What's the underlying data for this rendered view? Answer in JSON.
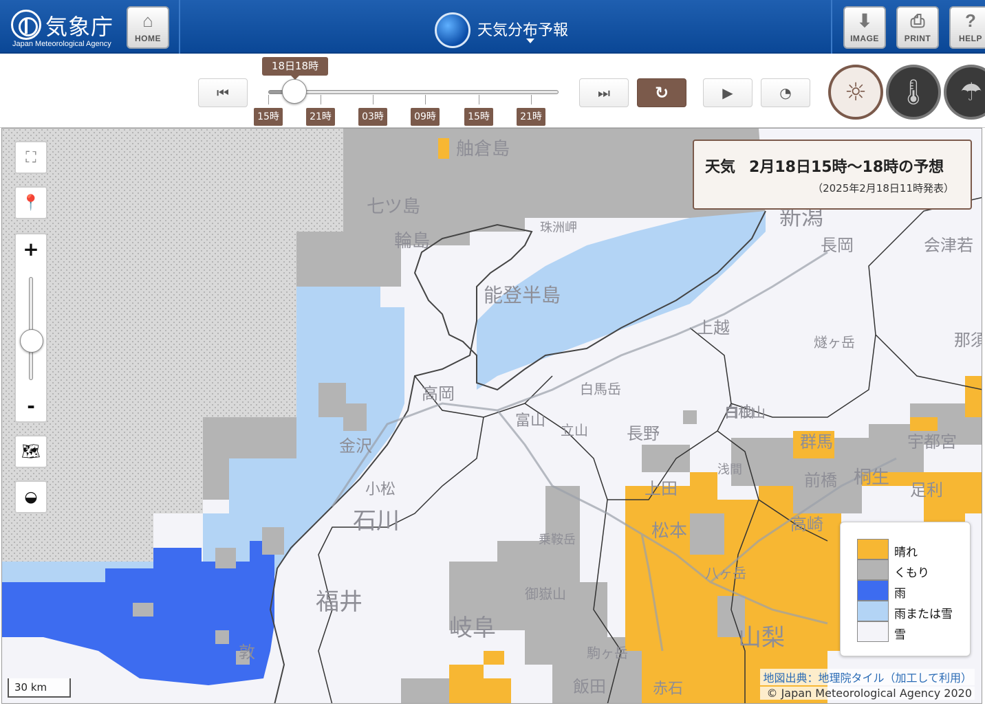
{
  "header": {
    "logo_ja": "気象庁",
    "logo_en": "Japan Meteorological Agency",
    "home_label": "HOME",
    "title": "天気分布予報",
    "image_label": "IMAGE",
    "print_label": "PRINT",
    "help_label": "HELP"
  },
  "timeline": {
    "current_label": "18日18時",
    "ticks": [
      "15時",
      "21時",
      "03時",
      "09時",
      "15時",
      "21時"
    ],
    "position_fraction": 0.09
  },
  "map": {
    "info_title_prefix": "天気",
    "info_title": "2月18日15時～18時の予想",
    "info_sub": "（2025年2月18日11時発表）",
    "scale_label": "30 km",
    "credit_source": "地図出典：地理院タイル（加工して利用）",
    "credit_copy": "© Japan Meteorological Agency 2020",
    "zoom_in": "+",
    "zoom_out": "-",
    "zoom_fraction": 0.45,
    "places": [
      "舳倉島",
      "七ツ島",
      "輪島",
      "能登半島",
      "新潟",
      "長岡",
      "会津若",
      "上越",
      "高岡",
      "富山",
      "立山",
      "長野",
      "白馬岳",
      "金沢",
      "小松",
      "石川",
      "福井",
      "敦",
      "岐阜",
      "飯田",
      "松本",
      "上田",
      "前橋",
      "桐生",
      "高崎",
      "宇都宮",
      "足利",
      "山梨",
      "赤石",
      "駒ヶ岳",
      "御嶽山",
      "白山",
      "那須",
      "八ヶ岳",
      "珠洲岬",
      "浅間",
      "燧ヶ岳",
      "白根山",
      "乗鞍岳",
      "群馬"
    ]
  },
  "legend": [
    {
      "label": "晴れ",
      "color": "#f7b733"
    },
    {
      "label": "くもり",
      "color": "#b4b4b4"
    },
    {
      "label": "雨",
      "color": "#3d6cf0"
    },
    {
      "label": "雨または雪",
      "color": "#b3d4f5"
    },
    {
      "label": "雪",
      "color": "#f4f4f9"
    }
  ]
}
